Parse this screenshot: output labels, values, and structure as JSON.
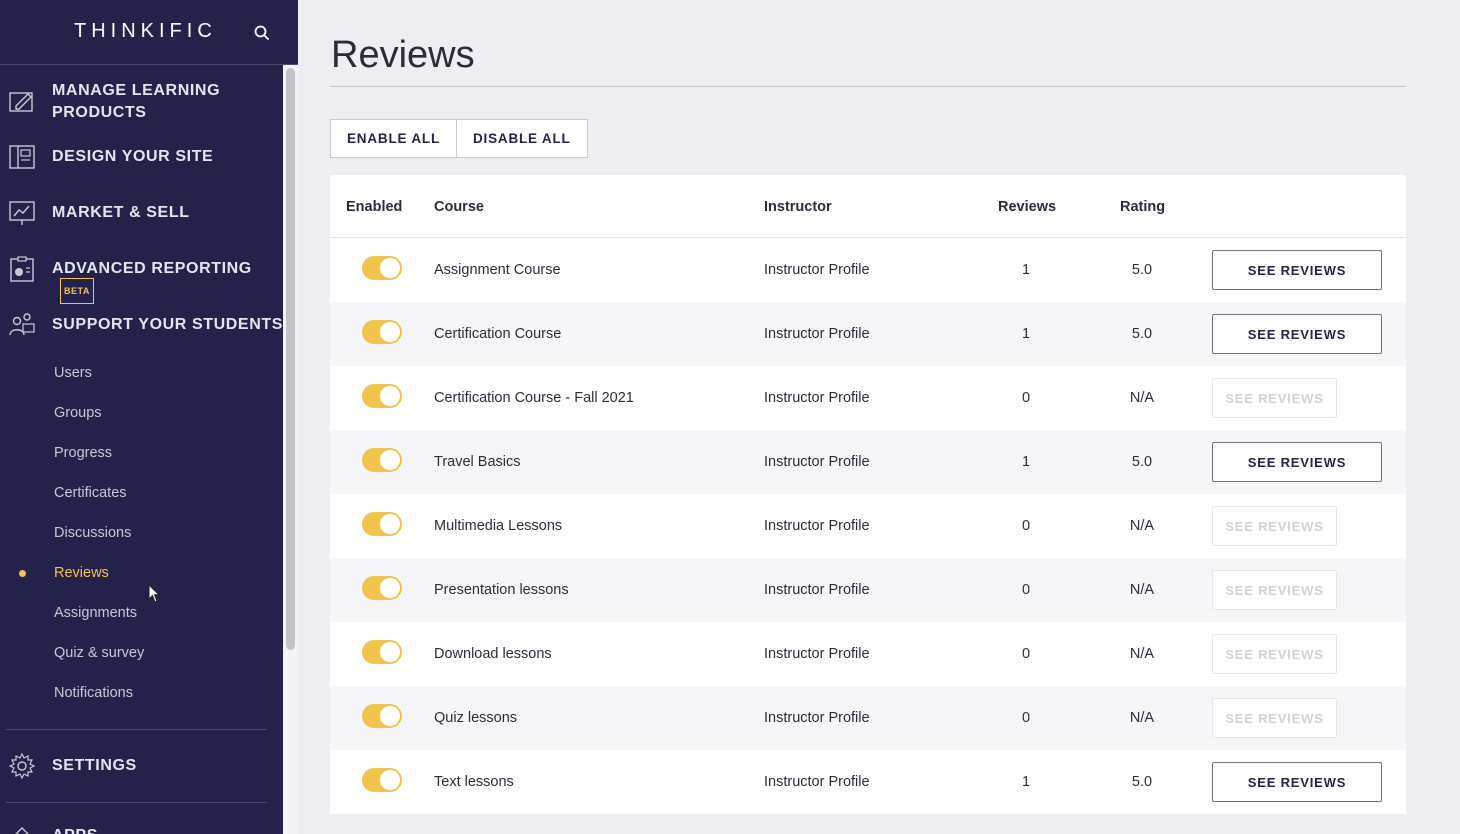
{
  "sidebar": {
    "logo": "THINKIFIC",
    "nav": [
      {
        "label": "MANAGE LEARNING\nPRODUCTS",
        "icon": "edit-icon"
      },
      {
        "label": "DESIGN YOUR SITE",
        "icon": "layout-icon"
      },
      {
        "label": "MARKET & SELL",
        "icon": "chart-icon"
      },
      {
        "label": "ADVANCED REPORTING",
        "icon": "report-icon",
        "badge": "BETA"
      },
      {
        "label": "SUPPORT YOUR STUDENTS",
        "icon": "students-icon"
      }
    ],
    "sub_items": [
      "Users",
      "Groups",
      "Progress",
      "Certificates",
      "Discussions",
      "Reviews",
      "Assignments",
      "Quiz & survey",
      "Notifications"
    ],
    "active_sub": "Reviews",
    "settings": "SETTINGS",
    "next_partial": "APPS"
  },
  "page": {
    "title": "Reviews",
    "enable_all": "ENABLE ALL",
    "disable_all": "DISABLE ALL"
  },
  "table": {
    "headers": {
      "enabled": "Enabled",
      "course": "Course",
      "instructor": "Instructor",
      "reviews": "Reviews",
      "rating": "Rating"
    },
    "button_label": "SEE REVIEWS",
    "rows": [
      {
        "course": "Assignment Course",
        "instructor": "Instructor Profile",
        "reviews": "1",
        "rating": "5.0",
        "enabled": true,
        "has_reviews": true
      },
      {
        "course": "Certification Course",
        "instructor": "Instructor Profile",
        "reviews": "1",
        "rating": "5.0",
        "enabled": true,
        "has_reviews": true
      },
      {
        "course": "Certification Course - Fall 2021",
        "instructor": "Instructor Profile",
        "reviews": "0",
        "rating": "N/A",
        "enabled": true,
        "has_reviews": false
      },
      {
        "course": "Travel Basics",
        "instructor": "Instructor Profile",
        "reviews": "1",
        "rating": "5.0",
        "enabled": true,
        "has_reviews": true
      },
      {
        "course": "Multimedia Lessons",
        "instructor": "Instructor Profile",
        "reviews": "0",
        "rating": "N/A",
        "enabled": true,
        "has_reviews": false
      },
      {
        "course": "Presentation lessons",
        "instructor": "Instructor Profile",
        "reviews": "0",
        "rating": "N/A",
        "enabled": true,
        "has_reviews": false
      },
      {
        "course": "Download lessons",
        "instructor": "Instructor Profile",
        "reviews": "0",
        "rating": "N/A",
        "enabled": true,
        "has_reviews": false
      },
      {
        "course": "Quiz lessons",
        "instructor": "Instructor Profile",
        "reviews": "0",
        "rating": "N/A",
        "enabled": true,
        "has_reviews": false
      },
      {
        "course": "Text lessons",
        "instructor": "Instructor Profile",
        "reviews": "1",
        "rating": "5.0",
        "enabled": true,
        "has_reviews": true
      }
    ]
  },
  "colors": {
    "sidebar_bg": "#24224a",
    "accent": "#f2c44d"
  }
}
